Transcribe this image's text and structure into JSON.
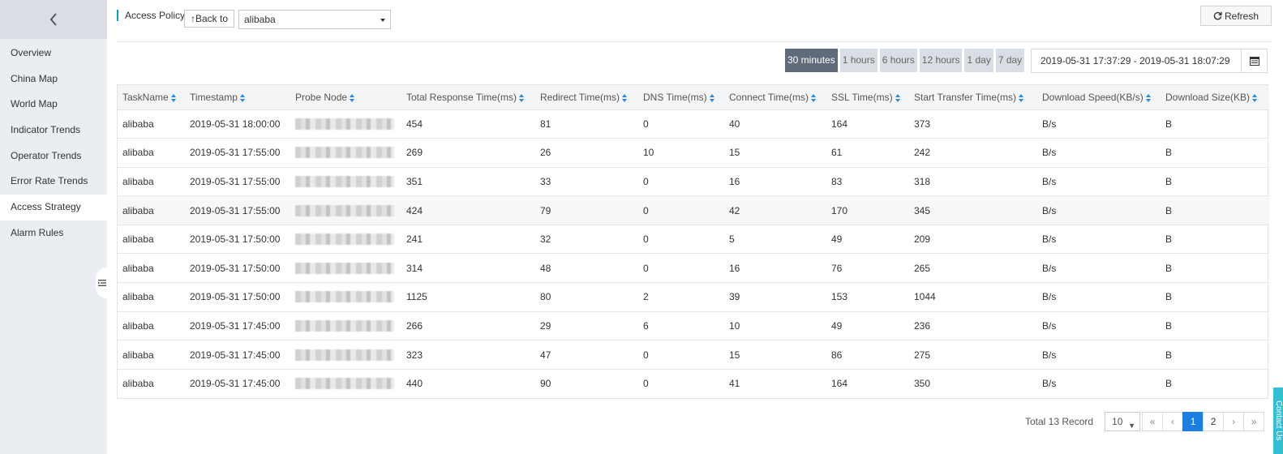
{
  "sidebar": {
    "items": [
      {
        "label": "Overview"
      },
      {
        "label": "China Map"
      },
      {
        "label": "World Map"
      },
      {
        "label": "Indicator Trends"
      },
      {
        "label": "Operator Trends"
      },
      {
        "label": "Error Rate Trends"
      },
      {
        "label": "Access Strategy",
        "active": true
      },
      {
        "label": "Alarm Rules"
      }
    ]
  },
  "header": {
    "title": "Access Policy",
    "back_label": "Back to",
    "task_select": "alibaba",
    "refresh_label": "Refresh"
  },
  "time_range": {
    "options": [
      "30 minutes",
      "1 hours",
      "6 hours",
      "12 hours",
      "1 day",
      "7 day"
    ],
    "active": "30 minutes",
    "date_range": "2019-05-31 17:37:29 - 2019-05-31 18:07:29"
  },
  "table": {
    "columns": [
      "TaskName",
      "Timestamp",
      "Probe Node",
      "Total Response Time(ms)",
      "Redirect Time(ms)",
      "DNS Time(ms)",
      "Connect Time(ms)",
      "SSL Time(ms)",
      "Start Transfer Time(ms)",
      "Download Speed(KB/s)",
      "Download Size(KB)"
    ],
    "rows": [
      {
        "task": "alibaba",
        "timestamp": "2019-05-31 18:00:00",
        "total": "454",
        "redirect": "81",
        "dns": "0",
        "connect": "40",
        "ssl": "164",
        "start_transfer": "373",
        "speed": "B/s",
        "size": "B"
      },
      {
        "task": "alibaba",
        "timestamp": "2019-05-31 17:55:00",
        "total": "269",
        "redirect": "26",
        "dns": "10",
        "connect": "15",
        "ssl": "61",
        "start_transfer": "242",
        "speed": "B/s",
        "size": "B"
      },
      {
        "task": "alibaba",
        "timestamp": "2019-05-31 17:55:00",
        "total": "351",
        "redirect": "33",
        "dns": "0",
        "connect": "16",
        "ssl": "83",
        "start_transfer": "318",
        "speed": "B/s",
        "size": "B"
      },
      {
        "task": "alibaba",
        "timestamp": "2019-05-31 17:55:00",
        "total": "424",
        "redirect": "79",
        "dns": "0",
        "connect": "42",
        "ssl": "170",
        "start_transfer": "345",
        "speed": "B/s",
        "size": "B"
      },
      {
        "task": "alibaba",
        "timestamp": "2019-05-31 17:50:00",
        "total": "241",
        "redirect": "32",
        "dns": "0",
        "connect": "5",
        "ssl": "49",
        "start_transfer": "209",
        "speed": "B/s",
        "size": "B"
      },
      {
        "task": "alibaba",
        "timestamp": "2019-05-31 17:50:00",
        "total": "314",
        "redirect": "48",
        "dns": "0",
        "connect": "16",
        "ssl": "76",
        "start_transfer": "265",
        "speed": "B/s",
        "size": "B"
      },
      {
        "task": "alibaba",
        "timestamp": "2019-05-31 17:50:00",
        "total": "1125",
        "redirect": "80",
        "dns": "2",
        "connect": "39",
        "ssl": "153",
        "start_transfer": "1044",
        "speed": "B/s",
        "size": "B"
      },
      {
        "task": "alibaba",
        "timestamp": "2019-05-31 17:45:00",
        "total": "266",
        "redirect": "29",
        "dns": "6",
        "connect": "10",
        "ssl": "49",
        "start_transfer": "236",
        "speed": "B/s",
        "size": "B"
      },
      {
        "task": "alibaba",
        "timestamp": "2019-05-31 17:45:00",
        "total": "323",
        "redirect": "47",
        "dns": "0",
        "connect": "15",
        "ssl": "86",
        "start_transfer": "275",
        "speed": "B/s",
        "size": "B"
      },
      {
        "task": "alibaba",
        "timestamp": "2019-05-31 17:45:00",
        "total": "440",
        "redirect": "90",
        "dns": "0",
        "connect": "41",
        "ssl": "164",
        "start_transfer": "350",
        "speed": "B/s",
        "size": "B"
      }
    ]
  },
  "pagination": {
    "total_text": "Total 13 Record",
    "page_size": "10",
    "first": "«",
    "prev": "‹",
    "pages": [
      "1",
      "2"
    ],
    "current": "1",
    "next": "›",
    "last": "»"
  },
  "contact_label": "Contact Us",
  "colors": {
    "accent": "#1b7ee0",
    "active_range": "#5f6b7a",
    "sidebar_bg": "#eaedf1"
  }
}
